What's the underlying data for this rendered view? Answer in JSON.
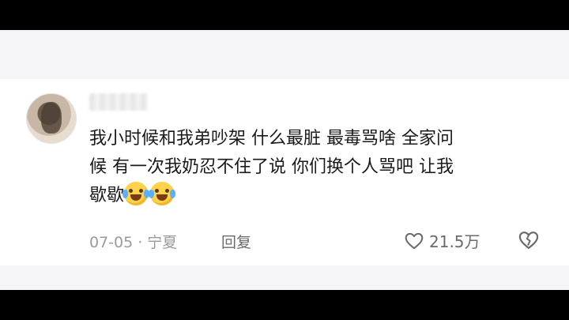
{
  "comment": {
    "username": "▪▪▪",
    "text_line_1": "我小时候和我弟吵架  什么最脏  最毒骂啥   全家问",
    "text_line_2": "候   有一次我奶忍不住了说  你们换个人骂吧  让我",
    "text_line_3": "歇歇",
    "emojis": [
      "laugh-cry-emoji",
      "laugh-cry-emoji"
    ],
    "date": "07-05",
    "separator": "·",
    "location": "宁夏",
    "reply_label": "回复",
    "like_count": "21.5万"
  },
  "colors": {
    "background": "#f5f5f7",
    "card": "#ffffff",
    "text": "#1a1a1a",
    "meta_text": "#9a9a9a",
    "action_text": "#6b6b6b"
  },
  "icons": {
    "like": "heart-outline-icon",
    "dislike": "broken-heart-outline-icon"
  }
}
